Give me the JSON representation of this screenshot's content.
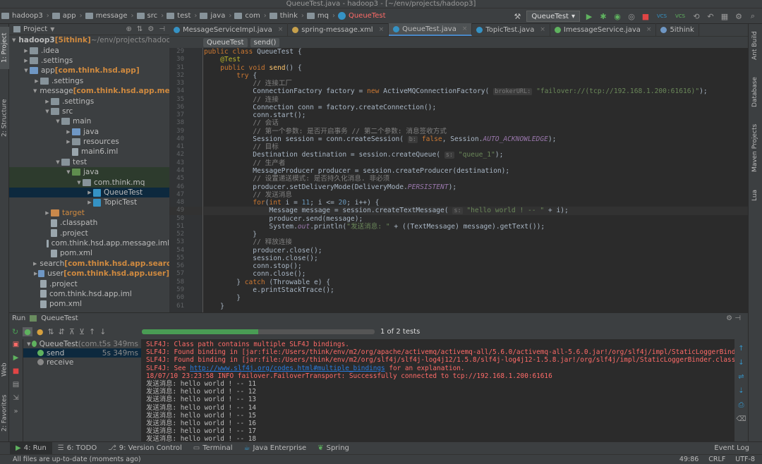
{
  "window": {
    "title": "QueueTest.java - hadoop3 - [~/env/projects/hadoop3]"
  },
  "nav": {
    "crumbs": [
      "hadoop3",
      "app",
      "message",
      "src",
      "test",
      "java",
      "com",
      "think",
      "mq",
      "QueueTest"
    ],
    "run_config": "QueueTest",
    "vcs1": "VCS",
    "vcs2": "VCS"
  },
  "left_stripe": {
    "project": "1: Project",
    "structure": "2: Structure",
    "web": "Web",
    "favorites": "2: Favorites"
  },
  "right_stripe": {
    "ant": "Ant Build",
    "database": "Database",
    "maven": "Maven Projects",
    "lua": "Lua"
  },
  "project_panel": {
    "title": "Project"
  },
  "tree": [
    {
      "depth": 0,
      "arrow": "▼",
      "icon": "fold",
      "name": "hadoop3",
      "extra": " [5ithink]",
      "tail": " ~/env/projects/hadoop3",
      "bold": true
    },
    {
      "depth": 1,
      "arrow": "▶",
      "icon": "fold",
      "name": ".idea"
    },
    {
      "depth": 1,
      "arrow": "▶",
      "icon": "fold",
      "name": ".settings"
    },
    {
      "depth": 1,
      "arrow": "▼",
      "icon": "foldb",
      "name": "app",
      "extra": " [com.think.hsd.app]",
      "boldx": true
    },
    {
      "depth": 2,
      "arrow": "▶",
      "icon": "fold",
      "name": ".settings"
    },
    {
      "depth": 2,
      "arrow": "▼",
      "icon": "foldb",
      "name": "message",
      "extra": " [com.think.hsd.app.message]",
      "boldx": true
    },
    {
      "depth": 3,
      "arrow": "▶",
      "icon": "fold",
      "name": ".settings"
    },
    {
      "depth": 3,
      "arrow": "▼",
      "icon": "fold",
      "name": "src"
    },
    {
      "depth": 4,
      "arrow": "▼",
      "icon": "fold",
      "name": "main"
    },
    {
      "depth": 5,
      "arrow": "▶",
      "icon": "foldb",
      "name": "java"
    },
    {
      "depth": 5,
      "arrow": "▶",
      "icon": "fold",
      "name": "resources"
    },
    {
      "depth": 5,
      "arrow": "",
      "icon": "filei",
      "name": "main6.iml"
    },
    {
      "depth": 4,
      "arrow": "▼",
      "icon": "fold",
      "name": "test"
    },
    {
      "depth": 5,
      "arrow": "▼",
      "icon": "foldg",
      "name": "java",
      "green": true
    },
    {
      "depth": 6,
      "arrow": "▼",
      "icon": "fold",
      "name": "com.think.mq",
      "green": true
    },
    {
      "depth": 7,
      "arrow": "▶",
      "icon": "ccls",
      "name": "QueueTest",
      "selected": true
    },
    {
      "depth": 7,
      "arrow": "▶",
      "icon": "ccls",
      "name": "TopicTest"
    },
    {
      "depth": 3,
      "arrow": "▶",
      "icon": "foldo",
      "name": "target",
      "orange": true
    },
    {
      "depth": 3,
      "arrow": "",
      "icon": "filei",
      "name": ".classpath"
    },
    {
      "depth": 3,
      "arrow": "",
      "icon": "filei",
      "name": ".project"
    },
    {
      "depth": 3,
      "arrow": "",
      "icon": "filei",
      "name": "com.think.hsd.app.message.iml"
    },
    {
      "depth": 3,
      "arrow": "",
      "icon": "filei",
      "name": "pom.xml"
    },
    {
      "depth": 2,
      "arrow": "▶",
      "icon": "foldb",
      "name": "search",
      "extra": " [com.think.hsd.app.search]",
      "boldx": true
    },
    {
      "depth": 2,
      "arrow": "▶",
      "icon": "foldb",
      "name": "user",
      "extra": " [com.think.hsd.app.user]",
      "boldx": true
    },
    {
      "depth": 2,
      "arrow": "",
      "icon": "filei",
      "name": ".project"
    },
    {
      "depth": 2,
      "arrow": "",
      "icon": "filei",
      "name": "com.think.hsd.app.iml"
    },
    {
      "depth": 2,
      "arrow": "",
      "icon": "filei",
      "name": "pom.xml"
    }
  ],
  "tabs": [
    {
      "name": "MessageServiceImpl.java",
      "color": "#3592c4"
    },
    {
      "name": "spring-message.xml",
      "color": "#c6a04c"
    },
    {
      "name": "QueueTest.java",
      "color": "#3592c4",
      "active": true
    },
    {
      "name": "TopicTest.java",
      "color": "#3592c4"
    },
    {
      "name": "ImessageService.java",
      "color": "#5fb25f"
    },
    {
      "name": "5ithink",
      "color": "#6f97c4"
    }
  ],
  "editor_crumbs": [
    "QueueTest",
    "send()"
  ],
  "line_numbers": [
    "29",
    "30",
    "31",
    "32",
    "33",
    "34",
    "35",
    "36",
    "37",
    "38",
    "39",
    "40",
    "41",
    "42",
    "43",
    "44",
    "45",
    "46",
    "47",
    "48",
    "49",
    "50",
    "51",
    "52",
    "53",
    "54",
    "55",
    "56",
    "57",
    "58",
    "59",
    "60",
    "61"
  ],
  "code_lines": [
    [
      [
        "kw",
        "public class "
      ],
      [
        "",
        "QueueTest {"
      ]
    ],
    [
      [
        "",
        "    "
      ],
      [
        "an",
        "@Test"
      ]
    ],
    [
      [
        "",
        "    "
      ],
      [
        "kw",
        "public void "
      ],
      [
        "fn",
        "send"
      ],
      [
        "",
        "() {"
      ]
    ],
    [
      [
        "",
        "        "
      ],
      [
        "kw",
        "try "
      ],
      [
        "",
        "{"
      ]
    ],
    [
      [
        "",
        "            "
      ],
      [
        "cm",
        "// 连接工厂"
      ]
    ],
    [
      [
        "",
        "            ConnectionFactory factory = "
      ],
      [
        "kw",
        "new "
      ],
      [
        "",
        "ActiveMQConnectionFactory( "
      ],
      [
        "hint",
        "brokerURL:"
      ],
      [
        "st",
        " \"failover://(tcp://192.168.1.200:61616)\""
      ],
      [
        "",
        ");"
      ]
    ],
    [
      [
        "",
        "            "
      ],
      [
        "cm",
        "// 连接"
      ]
    ],
    [
      [
        "",
        "            Connection conn = factory.createConnection();"
      ]
    ],
    [
      [
        "",
        "            conn.start();"
      ]
    ],
    [
      [
        "",
        "            "
      ],
      [
        "cm",
        "// 会话"
      ]
    ],
    [
      [
        "",
        "            "
      ],
      [
        "cm",
        "// 第一个参数: 是否开启事务 // 第二个参数: 消息签收方式"
      ]
    ],
    [
      [
        "",
        "            Session session = conn.createSession( "
      ],
      [
        "hint",
        "b:"
      ],
      [
        "kw",
        " false"
      ],
      [
        "",
        ", Session."
      ],
      [
        "it",
        "AUTO_ACKNOWLEDGE"
      ],
      [
        "",
        ");"
      ]
    ],
    [
      [
        "",
        "            "
      ],
      [
        "cm",
        "// 目标"
      ]
    ],
    [
      [
        "",
        "            Destination destination = session.createQueue( "
      ],
      [
        "hint",
        "s:"
      ],
      [
        "st",
        " \"queue_1\""
      ],
      [
        "",
        ");"
      ]
    ],
    [
      [
        "",
        "            "
      ],
      [
        "cm",
        "// 生产者"
      ]
    ],
    [
      [
        "",
        "            MessageProducer producer = session.createProducer(destination);"
      ]
    ],
    [
      [
        "",
        "            "
      ],
      [
        "cm",
        "// 设置递送模式: 是否持久化消息. 非必须"
      ]
    ],
    [
      [
        "",
        "            producer.setDeliveryMode(DeliveryMode."
      ],
      [
        "it",
        "PERSISTENT"
      ],
      [
        "",
        ");"
      ]
    ],
    [
      [
        "",
        "            "
      ],
      [
        "cm",
        "// 发送消息"
      ]
    ],
    [
      [
        "",
        "            "
      ],
      [
        "kw",
        "for"
      ],
      [
        "",
        "("
      ],
      [
        "kw",
        "int "
      ],
      [
        "",
        "i = "
      ],
      [
        "nm",
        "11"
      ],
      [
        "",
        "; i <= "
      ],
      [
        "nm",
        "20"
      ],
      [
        "",
        "; i++) {"
      ]
    ],
    [
      [
        "",
        "                Message message = session.createTextMessage( "
      ],
      [
        "hint",
        "s:"
      ],
      [
        "st",
        " \"hello world ! -- \""
      ],
      [
        "",
        " + i);"
      ]
    ],
    [
      [
        "",
        "                producer.send(message);"
      ]
    ],
    [
      [
        "",
        "                System."
      ],
      [
        "it",
        "out"
      ],
      [
        "",
        ".println("
      ],
      [
        "st",
        "\"发送消息: \""
      ],
      [
        "",
        " + ((TextMessage) message).getText());"
      ]
    ],
    [
      [
        "",
        "            }"
      ]
    ],
    [
      [
        "",
        "            "
      ],
      [
        "cm",
        "// 释放连接"
      ]
    ],
    [
      [
        "",
        "            producer.close();"
      ]
    ],
    [
      [
        "",
        "            session.close();"
      ]
    ],
    [
      [
        "",
        "            conn.stop();"
      ]
    ],
    [
      [
        "",
        "            conn.close();"
      ]
    ],
    [
      [
        "",
        "        } "
      ],
      [
        "kw",
        "catch "
      ],
      [
        "",
        "(Throwable e) {"
      ]
    ],
    [
      [
        "",
        "            e.printStackTrace();"
      ]
    ],
    [
      [
        "",
        "        }"
      ]
    ],
    [
      [
        "",
        "    }"
      ]
    ]
  ],
  "run_panel": {
    "run_label": "Run",
    "config": "QueueTest",
    "progress": 0.5,
    "progress_text": "1 of 2 tests"
  },
  "test_tree": [
    {
      "name": "QueueTest",
      "extra": "(com.t",
      "time": "5s 349ms",
      "depth": 0
    },
    {
      "name": "send",
      "time": "5s 349ms",
      "depth": 1,
      "selected": true
    },
    {
      "name": "receive",
      "time": "",
      "depth": 1
    }
  ],
  "console": [
    {
      "t": "SLF4J: Class path contains multiple SLF4J bindings.",
      "c": "err"
    },
    {
      "t": "SLF4J: Found binding in [jar:file:/Users/think/env/m2/org/apache/activemq/activemq-all/5.6.0/activemq-all-5.6.0.jar!/org/slf4j/impl/StaticLoggerBinder.class]",
      "c": "err"
    },
    {
      "t": "SLF4J: Found binding in [jar:file:/Users/think/env/m2/org/slf4j/slf4j-log4j12/1.5.8/slf4j-log4j12-1.5.8.jar!/org/slf4j/impl/StaticLoggerBinder.class]",
      "c": "err"
    },
    {
      "t": "SLF4J: See ",
      "c": "err",
      "link": "http://www.slf4j.org/codes.html#multiple_bindings",
      "after": " for an explanation."
    },
    {
      "t": "18/07/10 23:23:58 INFO failover.FailoverTransport: Successfully connected to tcp://192.168.1.200:61616",
      "c": "err"
    },
    {
      "t": "发送消息: hello world ! -- 11",
      "c": ""
    },
    {
      "t": "发送消息: hello world ! -- 12",
      "c": ""
    },
    {
      "t": "发送消息: hello world ! -- 13",
      "c": ""
    },
    {
      "t": "发送消息: hello world ! -- 14",
      "c": ""
    },
    {
      "t": "发送消息: hello world ! -- 15",
      "c": ""
    },
    {
      "t": "发送消息: hello world ! -- 16",
      "c": ""
    },
    {
      "t": "发送消息: hello world ! -- 17",
      "c": ""
    },
    {
      "t": "发送消息: hello world ! -- 18",
      "c": ""
    }
  ],
  "bottom_tabs": [
    {
      "label": "4: Run",
      "active": true
    },
    {
      "label": "6: TODO"
    },
    {
      "label": "9: Version Control"
    },
    {
      "label": "Terminal"
    },
    {
      "label": "Java Enterprise"
    },
    {
      "label": "Spring"
    }
  ],
  "event_log": "Event Log",
  "status": {
    "message": "All files are up-to-date (moments ago)",
    "position": "49:86",
    "line_sep": "CRLF",
    "encoding": "UTF-8"
  }
}
